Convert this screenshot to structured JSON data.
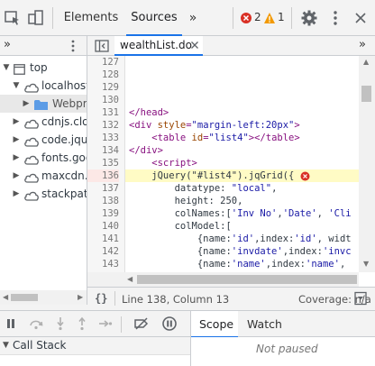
{
  "toolbar": {
    "tabs": [
      {
        "label": "Elements"
      },
      {
        "label": "Sources"
      }
    ],
    "more_tabs": "»",
    "errors": "2",
    "warnings": "1"
  },
  "navigator": {
    "more": "»",
    "items": [
      {
        "label": "top"
      },
      {
        "label": "localhost:"
      },
      {
        "label": "Webpro"
      },
      {
        "label": "cdnjs.clou"
      },
      {
        "label": "code.jque"
      },
      {
        "label": "fonts.goo"
      },
      {
        "label": "maxcdn.b"
      },
      {
        "label": "stackpath"
      }
    ]
  },
  "editor": {
    "more": "»",
    "file_tab": "wealthList.do",
    "lines": [
      {
        "n": "127"
      },
      {
        "n": "128"
      },
      {
        "n": "129"
      },
      {
        "n": "130"
      },
      {
        "n": "131"
      },
      {
        "n": "132"
      },
      {
        "n": "133"
      },
      {
        "n": "134"
      },
      {
        "n": "135"
      },
      {
        "n": "136"
      },
      {
        "n": "137"
      },
      {
        "n": "138"
      },
      {
        "n": "139"
      },
      {
        "n": "140"
      },
      {
        "n": "141"
      },
      {
        "n": "142"
      },
      {
        "n": "143"
      },
      {
        "n": "144"
      }
    ],
    "code": {
      "l131": "</head>",
      "l132_tag": "<div ",
      "l132_attr": "style",
      "l132_eq": "=",
      "l132_str": "\"margin-left:20px\"",
      "l132_end": ">",
      "l133_tag": "    <table ",
      "l133_attr": "id",
      "l133_eq": "=",
      "l133_str": "\"list4\"",
      "l133_end": "></table>",
      "l134": "</div>",
      "l135": "    <script>",
      "l136": "    jQuery(\"#list4\").jqGrid({",
      "l137_a": "        datatype: ",
      "l137_b": "\"local\"",
      "l137_c": ",",
      "l138": "        height: 250,",
      "l139_a": "        colNames:[",
      "l139_b": "'Inv No'",
      "l139_c": ",",
      "l139_d": "'Date'",
      "l139_e": ", ",
      "l139_f": "'Cli",
      "l140": "        colModel:[",
      "l141_a": "            {name:",
      "l141_b": "'id'",
      "l141_c": ",index:",
      "l141_d": "'id'",
      "l141_e": ", widt",
      "l142_a": "            {name:",
      "l142_b": "'invdate'",
      "l142_c": ",index:",
      "l142_d": "'invc",
      "l143_a": "            {name:",
      "l143_b": "'name'",
      "l143_c": ",index:",
      "l143_d": "'name'",
      "l143_e": ", "
    }
  },
  "status": {
    "format_icon": "{}",
    "position": "Line 138, Column 13",
    "coverage": "Coverage: n/a"
  },
  "debugger": {
    "call_stack": "Call Stack",
    "scope_tab": "Scope",
    "watch_tab": "Watch",
    "not_paused": "Not paused"
  },
  "colors": {
    "accent": "#1a73e8",
    "error": "#d93025",
    "warning": "#f29900",
    "highlight": "#fffbc5"
  }
}
